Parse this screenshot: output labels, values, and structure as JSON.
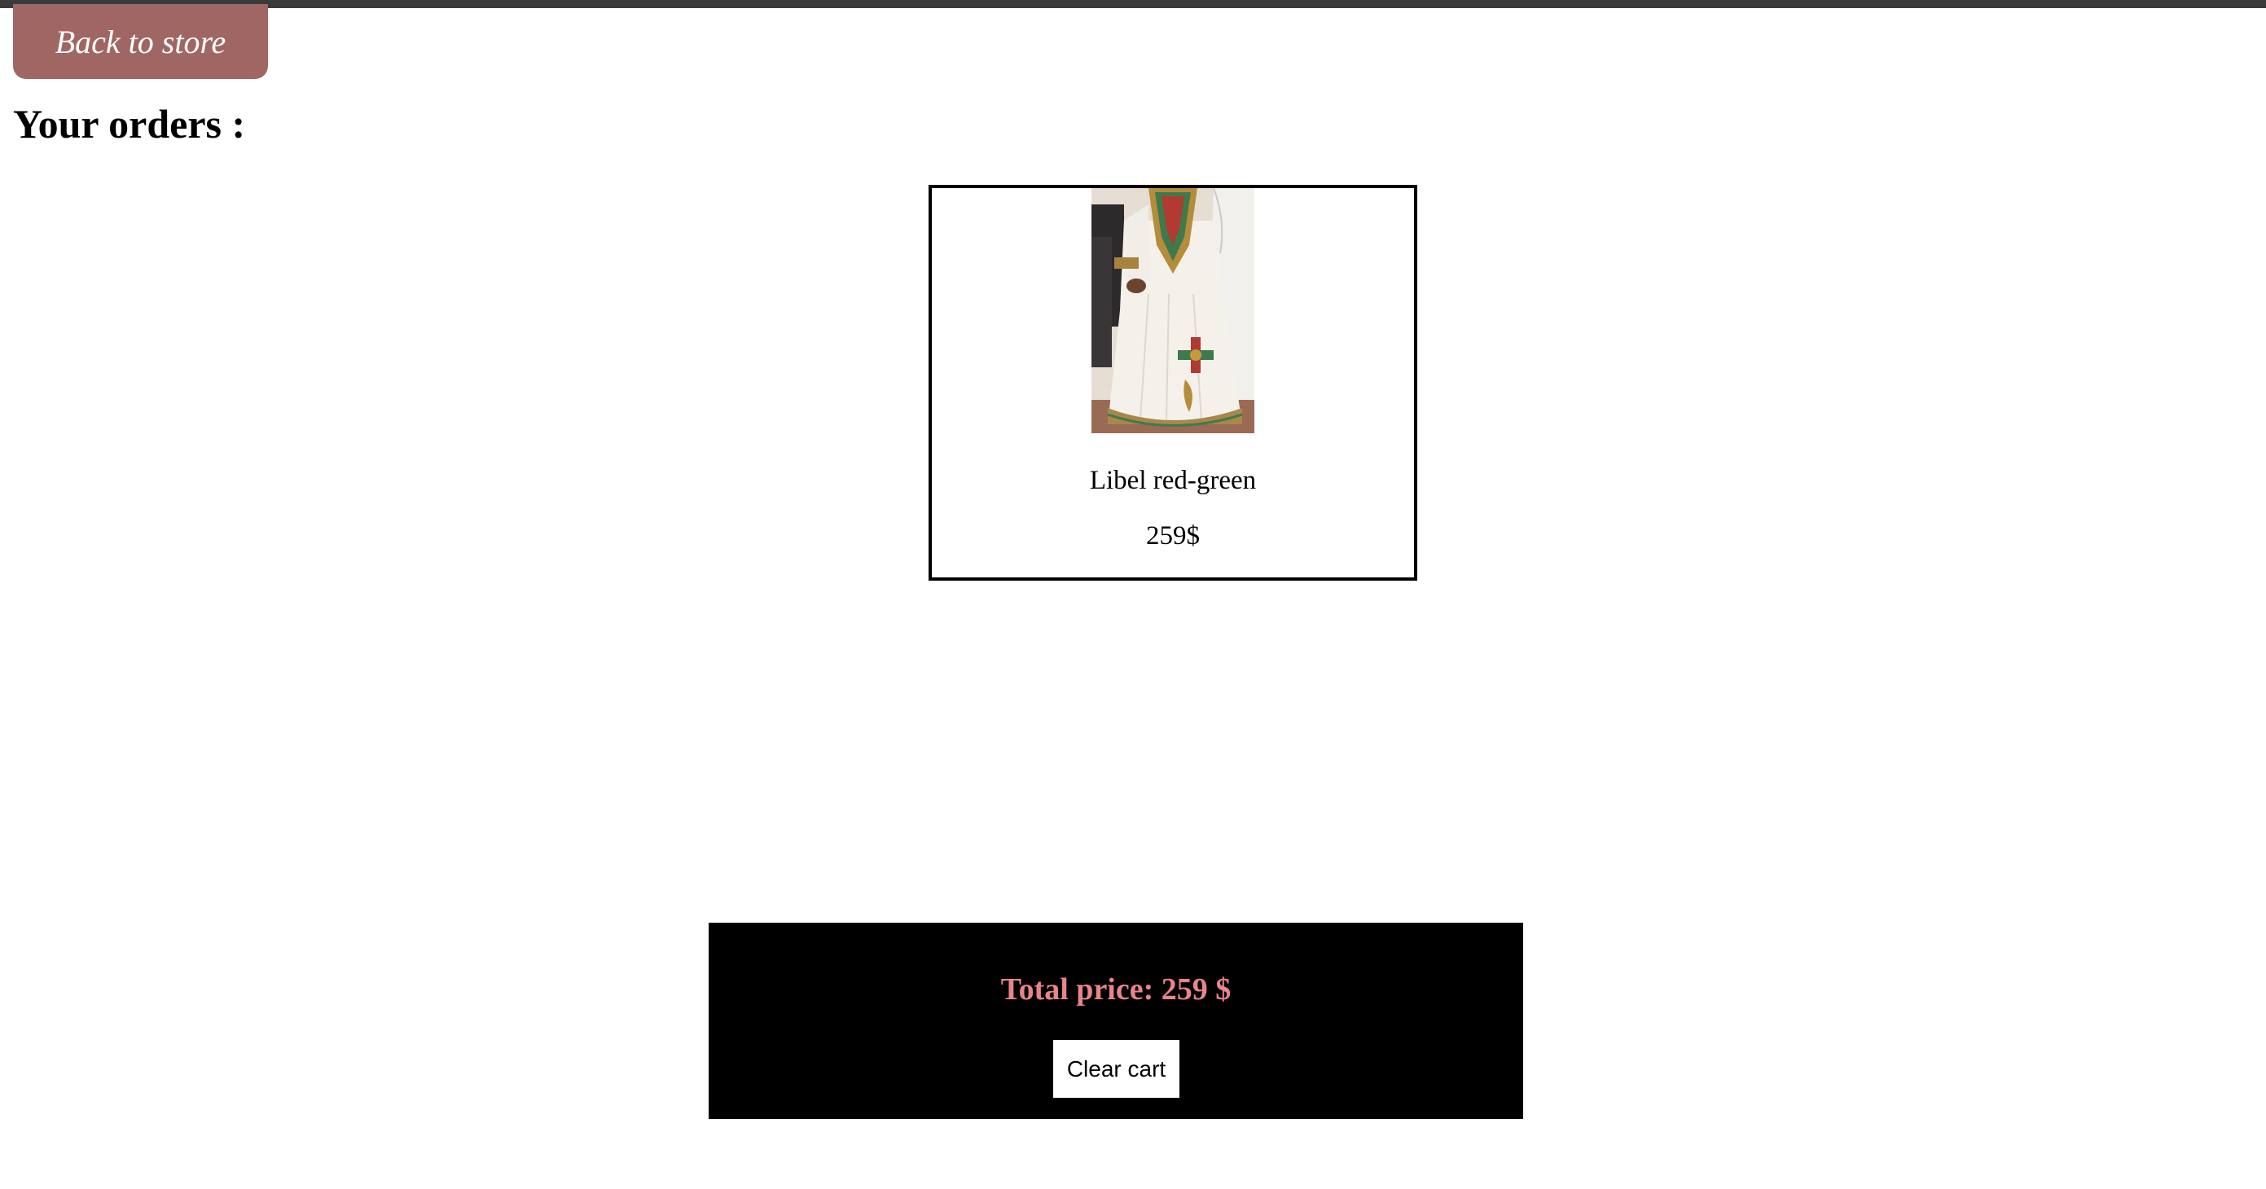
{
  "nav": {
    "back_label": "Back to store"
  },
  "orders": {
    "title": "Your orders :",
    "items": [
      {
        "name": "Libel red-green",
        "price": "259$",
        "image": "white-embroidered-dress-photo"
      }
    ]
  },
  "summary": {
    "total_label": "Total price: 259 $",
    "clear_label": "Clear cart"
  },
  "colors": {
    "back_button": "#a06663",
    "total_text": "#e8848a",
    "summary_bg": "#000000",
    "topbar": "#3a3a3c"
  }
}
